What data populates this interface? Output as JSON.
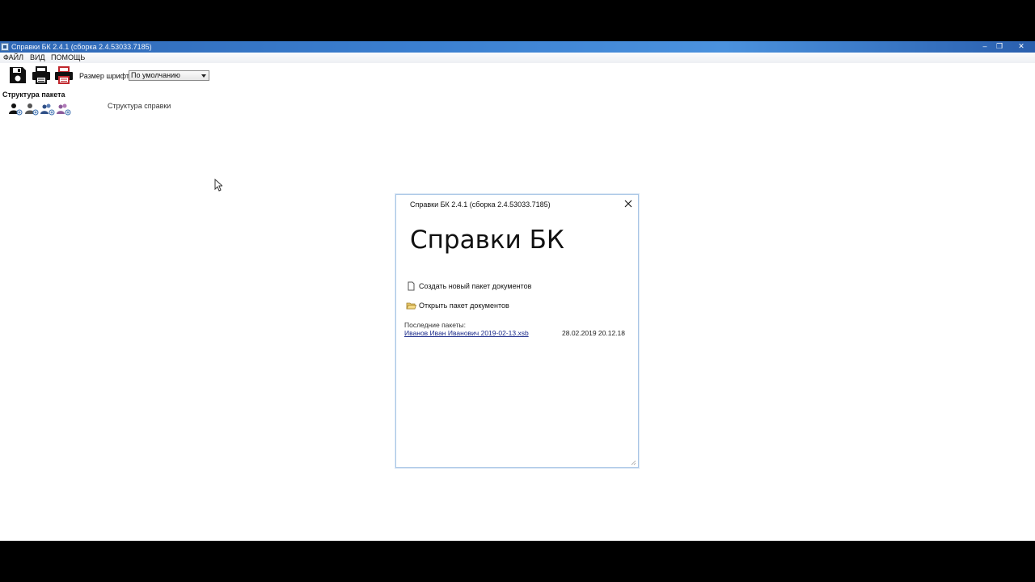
{
  "window": {
    "title": "Справки БК 2.4.1 (сборка 2.4.53033.7185)",
    "minimize": "‒",
    "maximize": "❐",
    "close": "✕"
  },
  "menu": {
    "file": "ФАЙЛ",
    "view": "ВИД",
    "help": "ПОМОЩЬ"
  },
  "toolbar": {
    "save_icon": "save-icon",
    "print_icon": "print-icon",
    "print_red_icon": "print-red-icon",
    "font_size_label": "Размер шрифта:",
    "font_size_value": "По умолчанию"
  },
  "package": {
    "title": "Структура пакета",
    "tools": [
      "add-person-icon",
      "add-person-icon",
      "add-person-group-icon",
      "add-person-group-icon"
    ],
    "structure_label": "Структура справки"
  },
  "dialog": {
    "title": "Справки БК 2.4.1 (сборка 2.4.53033.7185)",
    "heading": "Справки БК",
    "create_new": "Создать новый пакет документов",
    "open": "Открыть пакет документов",
    "recent_label": "Последние пакеты:",
    "recent": [
      {
        "name": "Иванов Иван Иванович 2019-02-13.xsb",
        "date": "28.02.2019 20.12.18"
      }
    ]
  },
  "colors": {
    "titlebar": "#3b7fd0",
    "dialog_border": "#a9c6e6",
    "link": "#1a2a8a",
    "print_red": "#c0272d"
  }
}
